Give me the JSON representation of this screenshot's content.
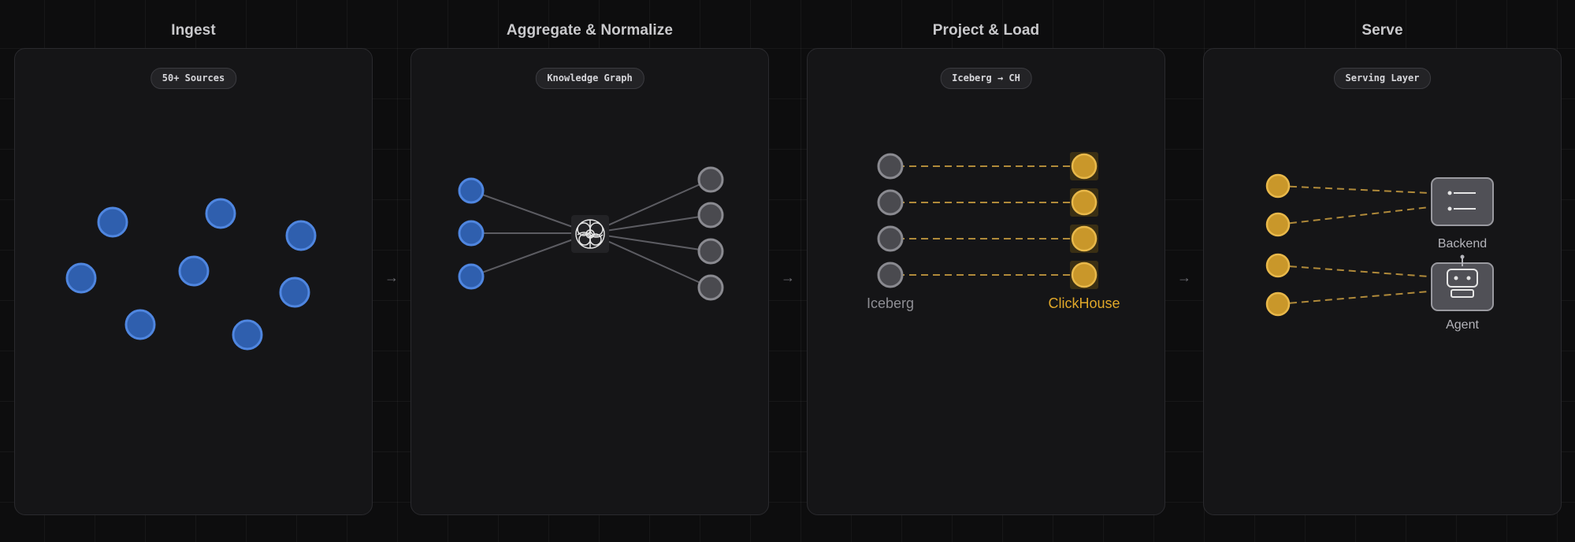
{
  "stages": [
    {
      "title": "Ingest",
      "badge": "50+ Sources"
    },
    {
      "title": "Aggregate & Normalize",
      "badge": "Knowledge Graph"
    },
    {
      "title": "Project & Load",
      "badge": "Iceberg → CH",
      "left_label": "Iceberg",
      "right_label": "ClickHouse"
    },
    {
      "title": "Serve",
      "badge": "Serving Layer",
      "backend_label": "Backend",
      "agent_label": "Agent"
    }
  ],
  "flow_arrow": "→",
  "colors": {
    "background": "#0d0d0e",
    "card": "#151517",
    "blue_node": "#2f5fae",
    "gray_node": "#4a4a4f",
    "gold_node": "#c9972a",
    "clickhouse_text": "#e0a729"
  }
}
